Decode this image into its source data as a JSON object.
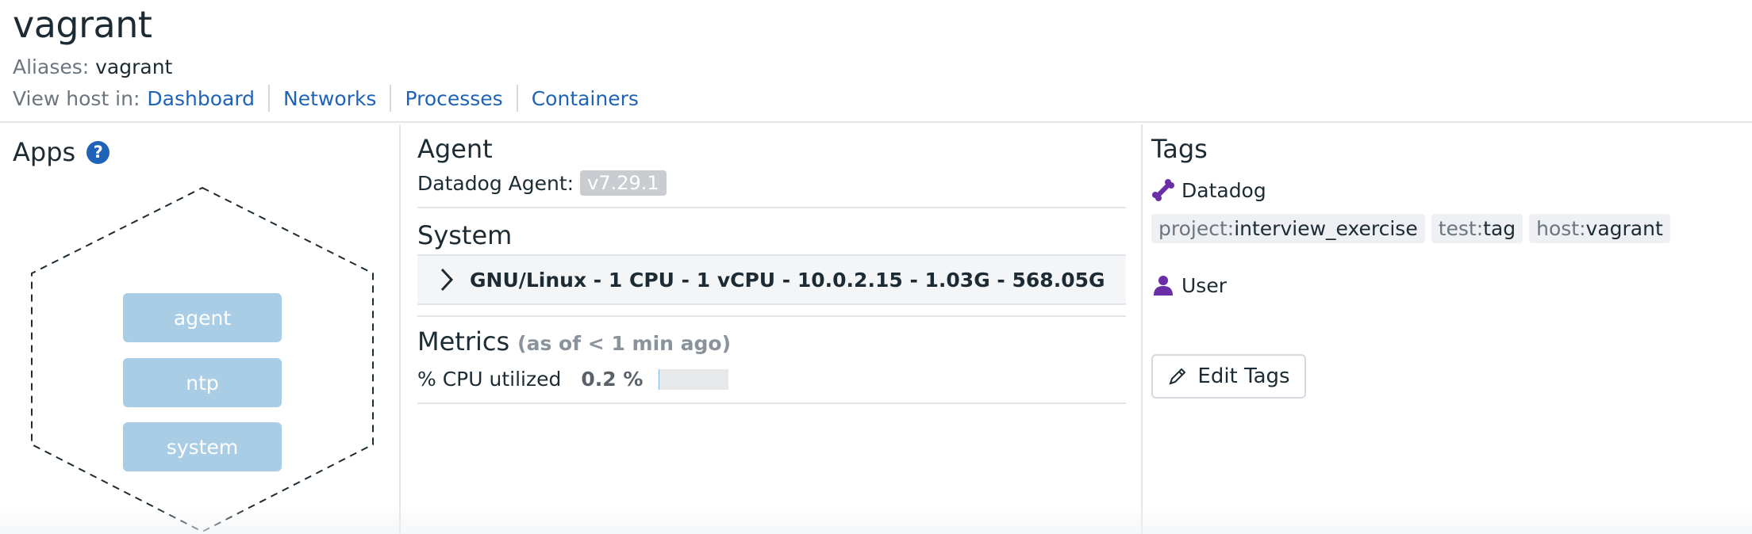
{
  "host": {
    "name": "vagrant",
    "aliases_label": "Aliases:",
    "aliases_value": "vagrant",
    "view_in_label": "View host in:",
    "links": [
      "Dashboard",
      "Networks",
      "Processes",
      "Containers"
    ]
  },
  "apps": {
    "title": "Apps",
    "help_icon": "?",
    "items": [
      "agent",
      "ntp",
      "system"
    ]
  },
  "agent": {
    "title": "Agent",
    "label": "Datadog Agent:",
    "version": "v7.29.1"
  },
  "system": {
    "title": "System",
    "summary": "GNU/Linux - 1 CPU - 1 vCPU - 10.0.2.15 - 1.03G - 568.05G"
  },
  "metrics": {
    "title": "Metrics",
    "subtitle": "(as of < 1 min ago)",
    "cpu_label": "% CPU utilized",
    "cpu_value": "0.2 %",
    "cpu_fraction": 0.002
  },
  "tags": {
    "title": "Tags",
    "datadog_source": "Datadog",
    "datadog_tags": [
      {
        "key": "project:",
        "value": "interview_exercise"
      },
      {
        "key": "test:",
        "value": "tag"
      },
      {
        "key": "host:",
        "value": "vagrant"
      }
    ],
    "user_source": "User",
    "edit_label": "Edit Tags"
  },
  "colors": {
    "link": "#1f63b8",
    "accent_purple": "#6a2ea6",
    "app_pill": "#a8cde4",
    "version_badge": "#c9ccd0"
  },
  "icons": {
    "help": "help-icon",
    "chevron": "chevron-right-icon",
    "datadog_source": "bone-icon",
    "user_source": "user-icon",
    "edit": "pencil-icon"
  }
}
